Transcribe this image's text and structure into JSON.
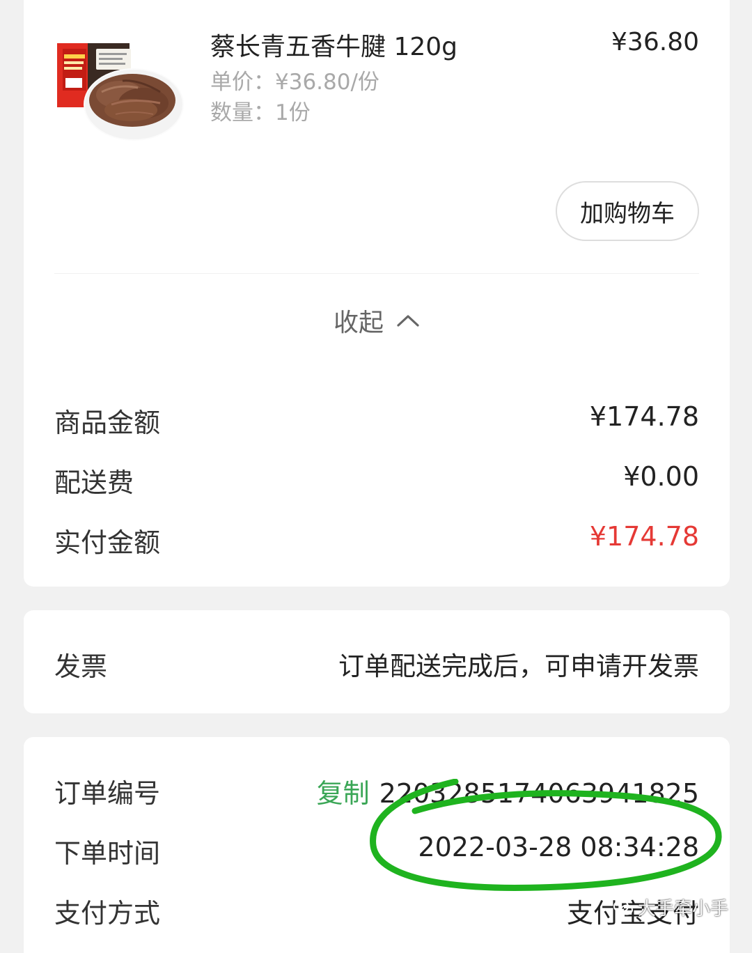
{
  "product": {
    "name": "蔡长青五香牛腱 120g",
    "price": "¥36.80",
    "unit_price": "单价：¥36.80/份",
    "quantity": "数量：1份",
    "add_to_cart_label": "加购物车",
    "package_brand_color": "#e02b20",
    "image_icon": "beef-slices-image"
  },
  "collapse": {
    "label": "收起",
    "icon": "chevron-up-icon"
  },
  "summary": {
    "items": [
      {
        "label": "商品金额",
        "value": "¥174.78"
      },
      {
        "label": "配送费",
        "value": "¥0.00"
      },
      {
        "label": "实付金额",
        "value": "¥174.78"
      }
    ],
    "highlight_color": "#e53935"
  },
  "invoice": {
    "label": "发票",
    "note": "订单配送完成后，可申请开发票"
  },
  "order": {
    "number_label": "订单编号",
    "copy_label": "复制",
    "number": "2203285174063941825",
    "time_label": "下单时间",
    "time": "2022-03-28 08:34:28",
    "payment_label": "支付方式",
    "payment": "支付宝支付",
    "accent_color": "#3aa656"
  },
  "annotation": {
    "circle_color": "#1fb31f"
  },
  "watermark": {
    "text": "大手牵小手"
  }
}
